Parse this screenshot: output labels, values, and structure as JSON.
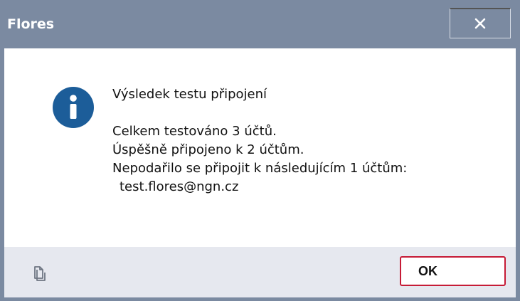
{
  "window": {
    "title": "Flores",
    "close_icon": "close-icon",
    "background": "#7b8aa1"
  },
  "message": {
    "icon": "info-icon",
    "heading": "Výsledek testu připojení",
    "line1": "Celkem testováno 3 účtů.",
    "line2": "Úspěšně připojeno k 2 účtům.",
    "line3": "Nepodařilo se připojit k následujícím 1 účtům:",
    "failed_account": "test.flores@ngn.cz"
  },
  "footer": {
    "copy_icon": "copy-icon",
    "ok_label": "OK",
    "accent": "#c61b36"
  }
}
